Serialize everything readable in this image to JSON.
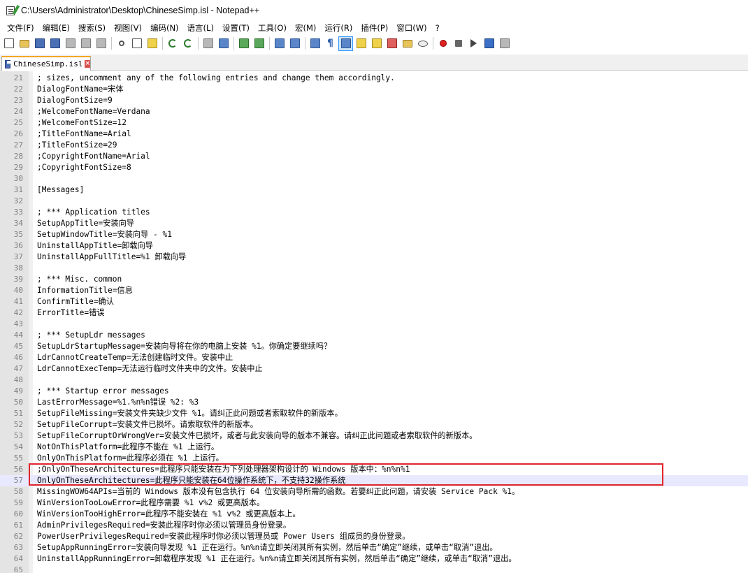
{
  "window": {
    "title": "C:\\Users\\Administrator\\Desktop\\ChineseSimp.isl - Notepad++"
  },
  "menu": [
    "文件(F)",
    "编辑(E)",
    "搜索(S)",
    "视图(V)",
    "编码(N)",
    "语言(L)",
    "设置(T)",
    "工具(O)",
    "宏(M)",
    "运行(R)",
    "插件(P)",
    "窗口(W)",
    "?"
  ],
  "toolbar": [
    {
      "icon": "new-file-icon",
      "style": "doc"
    },
    {
      "icon": "open-folder-icon",
      "style": "folder"
    },
    {
      "icon": "save-icon",
      "style": "disk"
    },
    {
      "icon": "save-all-icon",
      "style": "disk"
    },
    {
      "icon": "close-file-icon",
      "style": "gray"
    },
    {
      "icon": "close-all-icon",
      "style": "gray"
    },
    {
      "icon": "print-icon",
      "style": "gray"
    },
    {
      "sep": true
    },
    {
      "icon": "cut-icon",
      "style": "cut"
    },
    {
      "icon": "copy-icon",
      "style": "doc"
    },
    {
      "icon": "paste-icon",
      "style": "yellow"
    },
    {
      "sep": true
    },
    {
      "icon": "undo-icon",
      "style": "undo"
    },
    {
      "icon": "redo-icon",
      "style": "undo"
    },
    {
      "sep": true
    },
    {
      "icon": "find-icon",
      "style": "gray"
    },
    {
      "icon": "replace-icon",
      "style": "blue"
    },
    {
      "sep": true
    },
    {
      "icon": "zoom-in-icon",
      "style": "green"
    },
    {
      "icon": "zoom-out-icon",
      "style": "green"
    },
    {
      "sep": true
    },
    {
      "icon": "sync-vertical-icon",
      "style": "blue"
    },
    {
      "icon": "sync-horizontal-icon",
      "style": "blue"
    },
    {
      "sep": true
    },
    {
      "icon": "word-wrap-icon",
      "style": "blue"
    },
    {
      "icon": "show-all-chars-icon",
      "style": "para"
    },
    {
      "icon": "indent-guide-icon",
      "style": "blue",
      "active": true
    },
    {
      "icon": "define-language-icon",
      "style": "yellow"
    },
    {
      "icon": "document-map-icon",
      "style": "yellow"
    },
    {
      "icon": "function-list-icon",
      "style": "red"
    },
    {
      "icon": "folder-workspace-icon",
      "style": "folder"
    },
    {
      "icon": "monitoring-icon",
      "style": "eye"
    },
    {
      "sep": true
    },
    {
      "icon": "record-macro-icon",
      "style": "rec"
    },
    {
      "icon": "stop-macro-icon",
      "style": "stop"
    },
    {
      "icon": "play-macro-icon",
      "style": "play"
    },
    {
      "icon": "run-macro-multiple-icon",
      "style": "ff"
    },
    {
      "icon": "save-macro-icon",
      "style": "gray"
    }
  ],
  "tab": {
    "label": "ChineseSimp.isl"
  },
  "editor": {
    "current_line": "57",
    "lines": [
      {
        "n": "21",
        "text": "; sizes, uncomment any of the following entries and change them accordingly."
      },
      {
        "n": "22",
        "text": "DialogFontName=宋体"
      },
      {
        "n": "23",
        "text": "DialogFontSize=9"
      },
      {
        "n": "24",
        "text": ";WelcomeFontName=Verdana"
      },
      {
        "n": "25",
        "text": ";WelcomeFontSize=12"
      },
      {
        "n": "26",
        "text": ";TitleFontName=Arial"
      },
      {
        "n": "27",
        "text": ";TitleFontSize=29"
      },
      {
        "n": "28",
        "text": ";CopyrightFontName=Arial"
      },
      {
        "n": "29",
        "text": ";CopyrightFontSize=8"
      },
      {
        "n": "30",
        "text": ""
      },
      {
        "n": "31",
        "text": "[Messages]"
      },
      {
        "n": "32",
        "text": ""
      },
      {
        "n": "33",
        "text": "; *** Application titles"
      },
      {
        "n": "34",
        "text": "SetupAppTitle=安装向导"
      },
      {
        "n": "35",
        "text": "SetupWindowTitle=安装向导 - %1"
      },
      {
        "n": "36",
        "text": "UninstallAppTitle=卸载向导"
      },
      {
        "n": "37",
        "text": "UninstallAppFullTitle=%1 卸载向导"
      },
      {
        "n": "38",
        "text": ""
      },
      {
        "n": "39",
        "text": "; *** Misc. common"
      },
      {
        "n": "40",
        "text": "InformationTitle=信息"
      },
      {
        "n": "41",
        "text": "ConfirmTitle=确认"
      },
      {
        "n": "42",
        "text": "ErrorTitle=错误"
      },
      {
        "n": "43",
        "text": ""
      },
      {
        "n": "44",
        "text": "; *** SetupLdr messages"
      },
      {
        "n": "45",
        "text": "SetupLdrStartupMessage=安装向导将在你的电脑上安装 %1。你确定要继续吗？"
      },
      {
        "n": "46",
        "text": "LdrCannotCreateTemp=无法创建临时文件。安装中止"
      },
      {
        "n": "47",
        "text": "LdrCannotExecTemp=无法运行临时文件夹中的文件。安装中止"
      },
      {
        "n": "48",
        "text": ""
      },
      {
        "n": "49",
        "text": "; *** Startup error messages"
      },
      {
        "n": "50",
        "text": "LastErrorMessage=%1.%n%n错误 %2: %3"
      },
      {
        "n": "51",
        "text": "SetupFileMissing=安装文件夹缺少文件 %1。请纠正此问题或者索取软件的新版本。"
      },
      {
        "n": "52",
        "text": "SetupFileCorrupt=安装文件已损坏。请索取软件的新版本。"
      },
      {
        "n": "53",
        "text": "SetupFileCorruptOrWrongVer=安装文件已损坏，或者与此安装向导的版本不兼容。请纠正此问题或者索取软件的新版本。"
      },
      {
        "n": "54",
        "text": "NotOnThisPlatform=此程序不能在 %1 上运行。"
      },
      {
        "n": "55",
        "text": "OnlyOnThisPlatform=此程序必须在 %1 上运行。"
      },
      {
        "n": "56",
        "text": ";OnlyOnTheseArchitectures=此程序只能安装在为下列处理器架构设计的 Windows 版本中：%n%n%1"
      },
      {
        "n": "57",
        "text": "OnlyOnTheseArchitectures=此程序只能安装在64位操作系统下，不支持32操作系统"
      },
      {
        "n": "58",
        "text": "MissingWOW64APIs=当前的 Windows 版本没有包含执行 64 位安装向导所需的函数。若要纠正此问题，请安装 Service Pack %1。"
      },
      {
        "n": "59",
        "text": "WinVersionTooLowError=此程序需要 %1 v%2 或更高版本。"
      },
      {
        "n": "60",
        "text": "WinVersionTooHighError=此程序不能安装在 %1 v%2 或更高版本上。"
      },
      {
        "n": "61",
        "text": "AdminPrivilegesRequired=安装此程序时你必须以管理员身份登录。"
      },
      {
        "n": "62",
        "text": "PowerUserPrivilegesRequired=安装此程序时你必须以管理员或 Power Users 组成员的身份登录。"
      },
      {
        "n": "63",
        "text": "SetupAppRunningError=安装向导发现 %1 正在运行。%n%n请立即关闭其所有实例，然后单击“确定”继续，或单击“取消”退出。"
      },
      {
        "n": "64",
        "text": "UninstallAppRunningError=卸载程序发现 %1 正在运行。%n%n请立即关闭其所有实例，然后单击“确定”继续，或单击“取消”退出。"
      },
      {
        "n": "65",
        "text": ""
      }
    ]
  }
}
